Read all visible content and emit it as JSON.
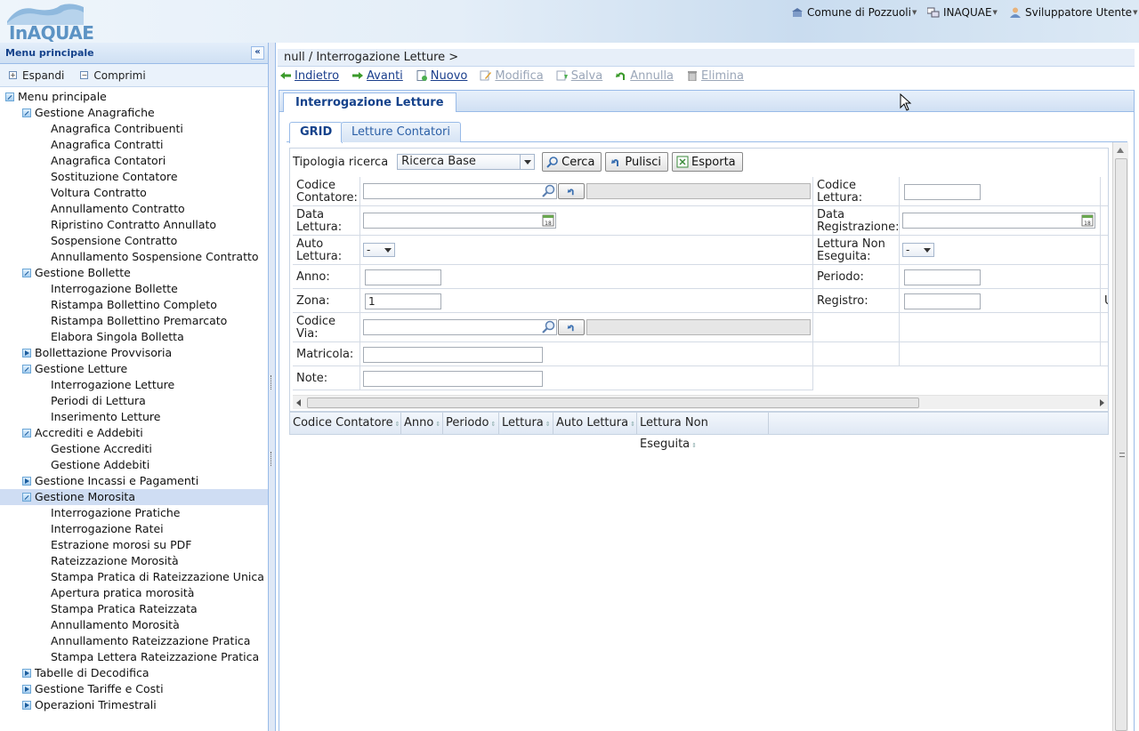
{
  "header": {
    "logo_text": "InAQUAE",
    "comune": "Comune di Pozzuoli",
    "ente": "INAQUAE",
    "user": "Sviluppatore Utente"
  },
  "sidebar": {
    "title": "Menu principale",
    "expand_label": "Espandi",
    "collapse_label": "Comprimi",
    "tree": [
      {
        "label": "Menu principale",
        "level": 0,
        "icon": "open"
      },
      {
        "label": "Gestione Anagrafiche",
        "level": 1,
        "icon": "open"
      },
      {
        "label": "Anagrafica Contribuenti",
        "level": 2
      },
      {
        "label": "Anagrafica Contratti",
        "level": 2
      },
      {
        "label": "Anagrafica Contatori",
        "level": 2
      },
      {
        "label": "Sostituzione Contatore",
        "level": 2
      },
      {
        "label": "Voltura Contratto",
        "level": 2
      },
      {
        "label": "Annullamento Contratto",
        "level": 2
      },
      {
        "label": "Ripristino Contratto Annullato",
        "level": 2
      },
      {
        "label": "Sospensione Contratto",
        "level": 2
      },
      {
        "label": "Annullamento Sospensione Contratto",
        "level": 2
      },
      {
        "label": "Gestione Bollette",
        "level": 1,
        "icon": "open"
      },
      {
        "label": "Interrogazione Bollette",
        "level": 2
      },
      {
        "label": "Ristampa Bollettino Completo",
        "level": 2
      },
      {
        "label": "Ristampa Bollettino Premarcato",
        "level": 2
      },
      {
        "label": "Elabora Singola Bolletta",
        "level": 2
      },
      {
        "label": "Bollettazione Provvisoria",
        "level": 1,
        "icon": "closed"
      },
      {
        "label": "Gestione Letture",
        "level": 1,
        "icon": "open"
      },
      {
        "label": "Interrogazione Letture",
        "level": 2
      },
      {
        "label": "Periodi di Lettura",
        "level": 2
      },
      {
        "label": "Inserimento Letture",
        "level": 2
      },
      {
        "label": "Accrediti e Addebiti",
        "level": 1,
        "icon": "open"
      },
      {
        "label": "Gestione Accrediti",
        "level": 2
      },
      {
        "label": "Gestione Addebiti",
        "level": 2
      },
      {
        "label": "Gestione Incassi e Pagamenti",
        "level": 1,
        "icon": "closed"
      },
      {
        "label": "Gestione Morosita",
        "level": 1,
        "icon": "open",
        "selected": true
      },
      {
        "label": "Interrogazione Pratiche",
        "level": 2
      },
      {
        "label": "Interrogazione Ratei",
        "level": 2
      },
      {
        "label": "Estrazione morosi su PDF",
        "level": 2
      },
      {
        "label": "Rateizzazione Morosità",
        "level": 2
      },
      {
        "label": "Stampa Pratica di Rateizzazione Unica",
        "level": 2
      },
      {
        "label": "Apertura pratica morosità",
        "level": 2
      },
      {
        "label": "Stampa Pratica Rateizzata",
        "level": 2
      },
      {
        "label": "Annullamento Morosità",
        "level": 2
      },
      {
        "label": "Annullamento Rateizzazione Pratica",
        "level": 2
      },
      {
        "label": "Stampa Lettera Rateizzazione Pratica",
        "level": 2
      },
      {
        "label": "Tabelle di Decodifica",
        "level": 1,
        "icon": "closed"
      },
      {
        "label": "Gestione Tariffe e Costi",
        "level": 1,
        "icon": "closed"
      },
      {
        "label": "Operazioni Trimestrali",
        "level": 1,
        "icon": "closed"
      }
    ]
  },
  "breadcrumb": "null / Interrogazione Letture >",
  "toolbar": {
    "back": "Indietro",
    "forward": "Avanti",
    "new": "Nuovo",
    "edit": "Modifica",
    "save": "Salva",
    "cancel": "Annulla",
    "delete": "Elimina"
  },
  "panel": {
    "title": "Interrogazione Letture",
    "tabs": [
      "GRID",
      "Letture Contatori"
    ]
  },
  "search": {
    "type_label": "Tipologia ricerca",
    "type_value": "Ricerca Base",
    "search_btn": "Cerca",
    "clear_btn": "Pulisci",
    "export_btn": "Esporta"
  },
  "form": {
    "codice_contatore_l1": "Codice",
    "codice_contatore_l2": "Contatore:",
    "codice_lettura_l1": "Codice",
    "codice_lettura_l2": "Lettura:",
    "data_lettura_l1": "Data",
    "data_lettura_l2": "Lettura:",
    "data_reg_l1": "Data",
    "data_reg_l2": "Registrazione:",
    "auto_lettura_l1": "Auto",
    "auto_lettura_l2": "Lettura:",
    "auto_lettura_value": "-",
    "non_eseguita_l1": "Lettura Non",
    "non_eseguita_l2": "Eseguita:",
    "non_eseguita_value": "-",
    "anno": "Anno:",
    "periodo": "Periodo:",
    "zona": "Zona:",
    "zona_value": "1",
    "registro": "Registro:",
    "clipped_label": "U",
    "codice_via_l1": "Codice",
    "codice_via_l2": "Via:",
    "matricola": "Matricola:",
    "note": "Note:"
  },
  "grid": {
    "columns": [
      "Codice Contatore",
      "Anno",
      "Periodo",
      "Lettura",
      "Auto Lettura",
      "Lettura Non Eseguita"
    ]
  }
}
